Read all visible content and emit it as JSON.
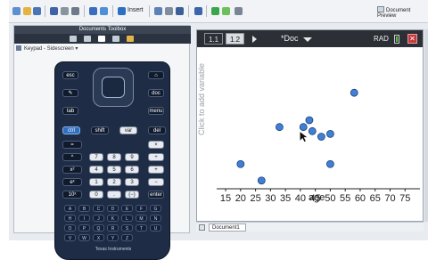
{
  "toolbar": {
    "insert_label": "Insert",
    "doc_preview_label": "Document Preview"
  },
  "left_panel": {
    "title": "Documents Toolbox",
    "keypad_selector": "Keypad - Sidescreen"
  },
  "calculator": {
    "brand": "Texas Instruments",
    "keys": {
      "esc": "esc",
      "tab": "tab",
      "on": "on",
      "doc": "doc",
      "menu": "menu",
      "ctrl": "ctrl",
      "shift": "shift",
      "var": "var",
      "del": "del",
      "enter": "enter",
      "digits": [
        "7",
        "8",
        "9",
        "4",
        "5",
        "6",
        "1",
        "2",
        "3",
        "0",
        ".",
        "(−)"
      ],
      "ops": [
        "×",
        "÷",
        "+",
        "−"
      ],
      "letters": [
        "A",
        "B",
        "C",
        "D",
        "E",
        "F",
        "G",
        "H",
        "I",
        "J",
        "K",
        "L",
        "M",
        "N",
        "O",
        "P",
        "Q",
        "R",
        "S",
        "T",
        "U",
        "V",
        "W",
        "X",
        "Y",
        "Z"
      ]
    }
  },
  "document": {
    "tab_1": "1.1",
    "tab_2": "1.2",
    "title": "*Doc",
    "mode": "RAD",
    "y_axis_hint": "Click to add variable",
    "x_axis_label": "age"
  },
  "status": {
    "doc_tab": "Document1"
  },
  "chart_data": {
    "type": "scatter",
    "xlabel": "age",
    "ylabel": "",
    "xlim": [
      12,
      80
    ],
    "xticks": [
      15,
      20,
      25,
      30,
      35,
      40,
      45,
      50,
      55,
      60,
      65,
      70,
      75
    ],
    "xtick_labels": [
      "15",
      "20",
      "25",
      "30",
      "35",
      "40",
      "45",
      "50",
      "55",
      "60",
      "65",
      "70",
      "75"
    ],
    "points": [
      {
        "x": 20,
        "y": 0.18
      },
      {
        "x": 27,
        "y": 0.06
      },
      {
        "x": 33,
        "y": 0.45
      },
      {
        "x": 41,
        "y": 0.45
      },
      {
        "x": 43,
        "y": 0.5
      },
      {
        "x": 44,
        "y": 0.42
      },
      {
        "x": 47,
        "y": 0.38
      },
      {
        "x": 50,
        "y": 0.4
      },
      {
        "x": 50,
        "y": 0.18
      },
      {
        "x": 58,
        "y": 0.7
      }
    ],
    "point_color": "#3f7fd6",
    "grid": false
  }
}
